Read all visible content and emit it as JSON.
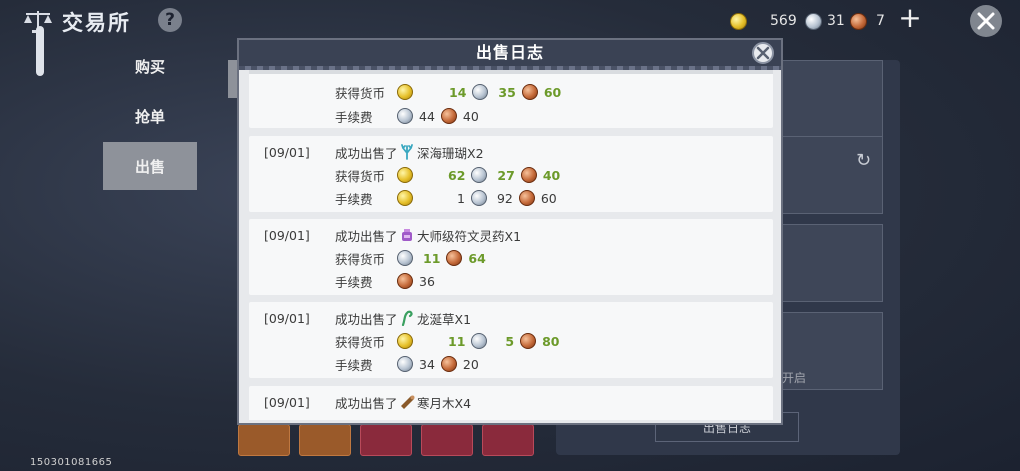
{
  "header": {
    "title": "交易所",
    "help_label": "?",
    "plus_label": "+",
    "currencies": [
      {
        "type": "gold",
        "amount": "569"
      },
      {
        "type": "silver",
        "amount": "31"
      },
      {
        "type": "copper",
        "amount": "7"
      }
    ]
  },
  "sidebar": {
    "tabs": [
      {
        "label": "购买"
      },
      {
        "label": "抢单"
      },
      {
        "label": "出售"
      }
    ]
  },
  "background": {
    "open_text": "开启",
    "log_button_label": "出售日志"
  },
  "footer": {
    "player_id": "150301081665"
  },
  "modal": {
    "title": "出售日志",
    "entries": [
      {
        "partial": true,
        "earned_label": "获得货币",
        "fee_label": "手续费",
        "earned": {
          "gold": "14",
          "silver": "35",
          "copper": "60"
        },
        "fee": {
          "silver": "44",
          "copper": "40"
        }
      },
      {
        "date": "[09/01]",
        "sold_label": "成功出售了",
        "item_icon": "coral-icon",
        "item": "深海珊瑚X2",
        "earned_label": "获得货币",
        "fee_label": "手续费",
        "earned": {
          "gold": "62",
          "silver": "27",
          "copper": "40"
        },
        "fee": {
          "gold": "1",
          "silver": "92",
          "copper": "60"
        }
      },
      {
        "date": "[09/01]",
        "sold_label": "成功出售了",
        "item_icon": "potion-icon",
        "item": "大师级符文灵药X1",
        "earned_label": "获得货币",
        "fee_label": "手续费",
        "earned": {
          "silver": "11",
          "copper": "64"
        },
        "fee": {
          "copper": "36"
        }
      },
      {
        "date": "[09/01]",
        "sold_label": "成功出售了",
        "item_icon": "herb-icon",
        "item": "龙涎草X1",
        "earned_label": "获得货币",
        "fee_label": "手续费",
        "earned": {
          "gold": "11",
          "silver": "5",
          "copper": "80"
        },
        "fee": {
          "silver": "34",
          "copper": "20"
        }
      },
      {
        "date": "[09/01]",
        "sold_label": "成功出售了",
        "item_icon": "wood-icon",
        "item": "寒月木X4"
      }
    ]
  }
}
